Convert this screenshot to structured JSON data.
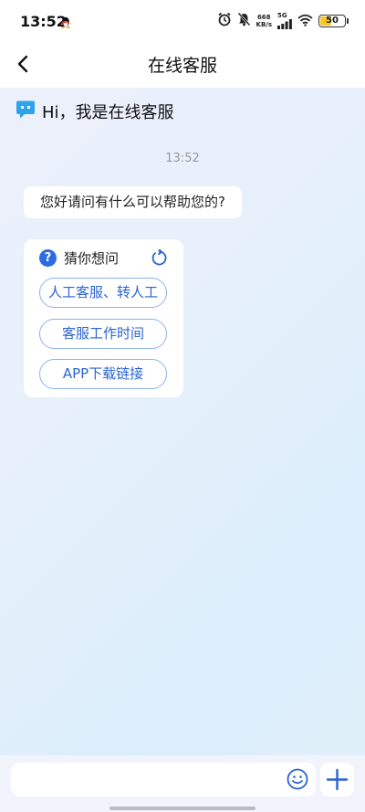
{
  "status_bar": {
    "time": "13:52",
    "net_speed_value": "668",
    "net_speed_unit": "KB/s",
    "signal_label": "5G",
    "battery_level": "50",
    "battery_fraction": 0.5
  },
  "header": {
    "title": "在线客服",
    "back_icon": "chevron-left-icon"
  },
  "chat": {
    "welcome_text": "Hi，我是在线客服",
    "timestamp": "13:52",
    "greeting_message": "您好请问有什么可以帮助您的?",
    "suggestion_card": {
      "title": "猜你想问",
      "options": [
        "人工客服、转人工",
        "客服工作时间",
        "APP下载链接"
      ]
    }
  },
  "input_bar": {
    "placeholder": "",
    "emoji_icon": "smiley-icon",
    "plus_icon": "plus-icon"
  },
  "colors": {
    "accent": "#2a63d1",
    "option_border": "#8db1ef",
    "assistant_icon": "#2fa3e8",
    "battery": "#f7c72a"
  }
}
